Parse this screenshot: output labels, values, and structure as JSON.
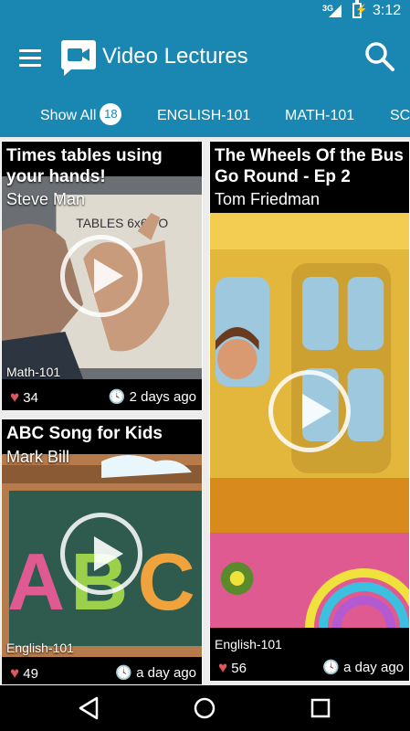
{
  "status_bar": {
    "network": "3G",
    "time": "3:12"
  },
  "app_bar": {
    "title": "Video Lectures"
  },
  "tabs": [
    {
      "label": "Show All",
      "badge": "18"
    },
    {
      "label": "ENGLISH-101"
    },
    {
      "label": "MATH-101"
    },
    {
      "label": "SC"
    }
  ],
  "videos": [
    {
      "title": "Times tables using your hands!",
      "author": "Steve Man",
      "course": "Math-101",
      "likes": "34",
      "time": "2 days ago"
    },
    {
      "title": "The Wheels Of the Bus Go Round - Ep 2",
      "author": "Tom Friedman",
      "course": "English-101",
      "likes": "56",
      "time": "a day ago"
    },
    {
      "title": "ABC Song for Kids",
      "author": "Mark Bill",
      "course": "English-101",
      "likes": "49",
      "time": "a day ago"
    }
  ],
  "colors": {
    "primary": "#1a87b2",
    "heart": "#e0565e"
  },
  "icons": [
    "menu-icon",
    "video-camera-icon",
    "search-icon",
    "heart-icon",
    "clock-icon",
    "play-icon",
    "back-icon",
    "home-icon",
    "recents-icon"
  ]
}
